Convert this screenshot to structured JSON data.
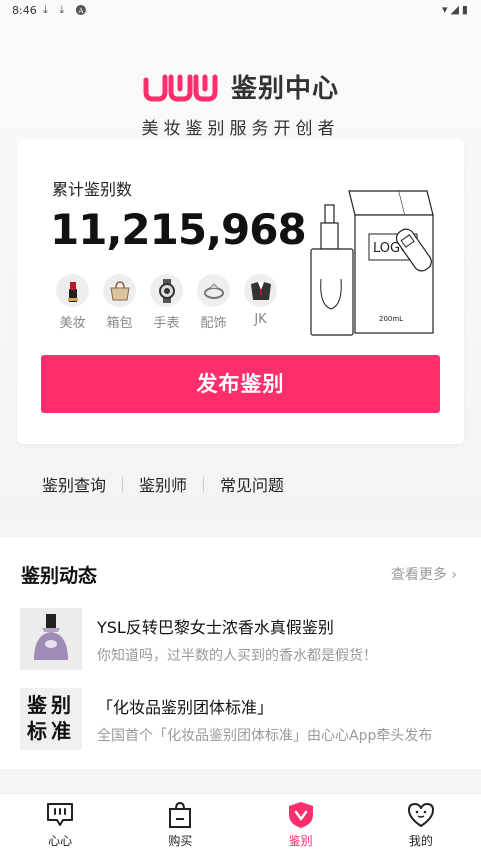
{
  "status_bar": {
    "time": "8:46",
    "notifications": "⤓ ⤓ 🅐",
    "system": "▾◢▮"
  },
  "header": {
    "brand_name": "鉴别中心",
    "slogan": "美妆鉴别服务开创者"
  },
  "stats": {
    "label": "累计鉴别数",
    "count": "11,215,968",
    "illustration": {
      "logo_text": "LOGO",
      "volume_text": "200mL"
    },
    "categories": [
      {
        "label": "美妆",
        "icon": "lipstick-icon"
      },
      {
        "label": "箱包",
        "icon": "handbag-icon"
      },
      {
        "label": "手表",
        "icon": "watch-icon"
      },
      {
        "label": "配饰",
        "icon": "ring-icon"
      },
      {
        "label": "JK",
        "icon": "jk-uniform-icon"
      }
    ],
    "publish_button": "发布鉴别"
  },
  "quick_links": [
    "鉴别查询",
    "鉴别师",
    "常见问题"
  ],
  "news": {
    "title": "鉴别动态",
    "more": "查看更多",
    "items": [
      {
        "title": "YSL反转巴黎女士浓香水真假鉴别",
        "desc": "你知道吗，过半数的人买到的香水都是假货！",
        "thumb": "perfume-bottle"
      },
      {
        "title": "「化妆品鉴别团体标准」",
        "desc": "全国首个「化妆品鉴别团体标准」由心心App牵头发布",
        "thumb_text": "鉴别标准"
      }
    ]
  },
  "bottom_nav": [
    {
      "label": "心心",
      "icon": "xinxin-icon"
    },
    {
      "label": "购买",
      "icon": "shopping-bag-icon"
    },
    {
      "label": "鉴别",
      "icon": "shield-v-icon",
      "active": true
    },
    {
      "label": "我的",
      "icon": "heart-face-icon"
    }
  ],
  "colors": {
    "accent": "#fe2d6b",
    "text": "#222222",
    "muted": "#999999"
  }
}
